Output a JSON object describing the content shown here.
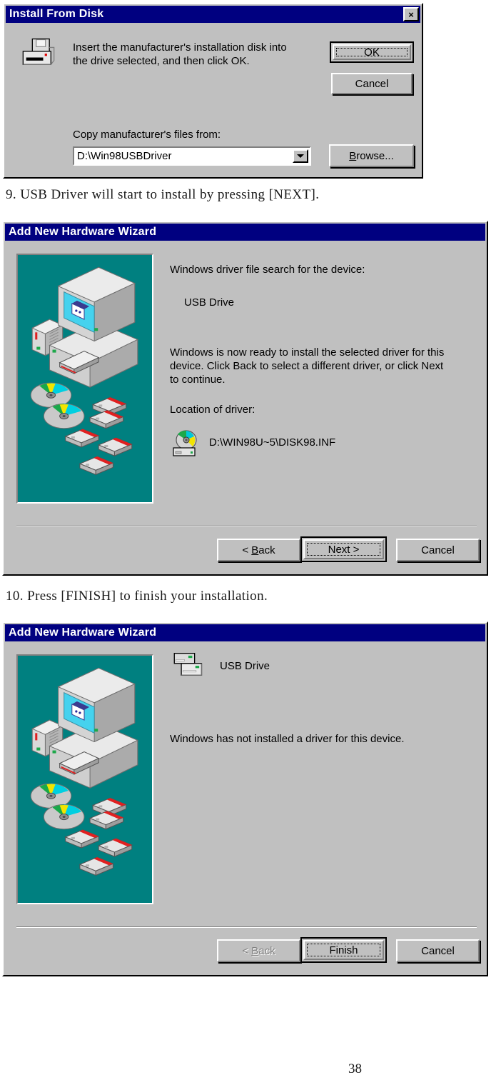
{
  "page": {
    "number": "38"
  },
  "steps": [
    {
      "text": "9. USB Driver will start to install by pressing [NEXT]."
    },
    {
      "text": "10. Press [FINISH] to finish your installation."
    }
  ],
  "install_from_disk": {
    "title": "Install From Disk",
    "close_label": "×",
    "icon": "floppy-disk-drive-icon",
    "message": "Insert the manufacturer's installation disk into\nthe drive selected, and then click OK.",
    "field_label": "Copy manufacturer's files from:",
    "path_value": "D:\\Win98USBDriver",
    "buttons": {
      "ok": "OK",
      "cancel": "Cancel",
      "browse_prefix": "B",
      "browse_rest": "rowse..."
    }
  },
  "wizard_search": {
    "title": "Add New Hardware Wizard",
    "heading": "Windows driver file search for the device:",
    "device_name": "USB Drive",
    "body": "Windows is now ready to install the selected driver for this\ndevice. Click Back to select a different driver, or click Next\nto continue.",
    "location_label": "Location of driver:",
    "location_icon": "cd-drive-icon",
    "location_value": "D:\\WIN98U~5\\DISK98.INF",
    "buttons": {
      "back_prefix": "< ",
      "back_key": "B",
      "back_rest": "ack",
      "next": "Next >",
      "cancel": "Cancel"
    }
  },
  "wizard_finish": {
    "title": "Add New Hardware Wizard",
    "device_icon": "usb-drive-icon",
    "device_name": "USB Drive",
    "message": "Windows has not installed a driver for this device.",
    "buttons": {
      "back_prefix": "< ",
      "back_key": "B",
      "back_rest": "ack",
      "finish": "Finish",
      "cancel": "Cancel"
    }
  },
  "colors": {
    "titlebar": "#000080",
    "face": "#c0c0c0",
    "art_background": "#008080",
    "text": "#000000"
  }
}
